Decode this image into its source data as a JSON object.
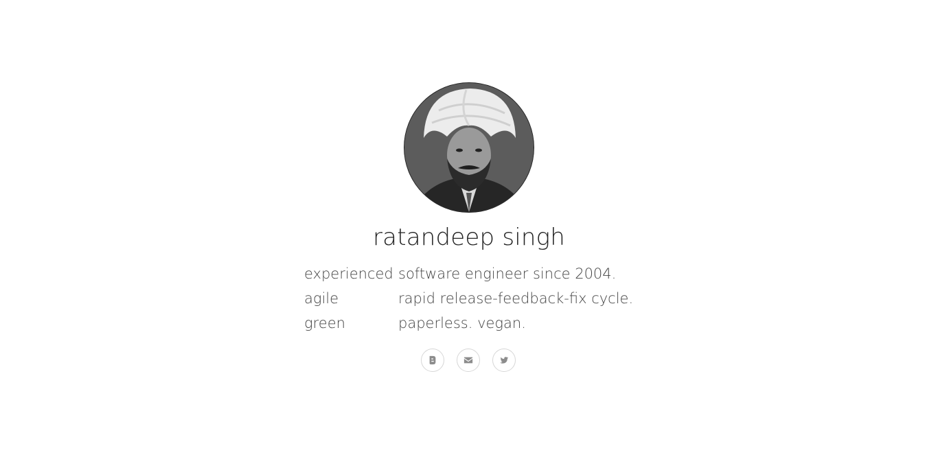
{
  "profile": {
    "name": "ratandeep singh",
    "facts": [
      {
        "key": "experienced",
        "value": "software engineer since 2004."
      },
      {
        "key": "agile",
        "value": "rapid release-feedback-fix cycle."
      },
      {
        "key": "green",
        "value": "paperless. vegan."
      }
    ]
  },
  "social": [
    {
      "icon": "blogger-icon"
    },
    {
      "icon": "envelope-icon"
    },
    {
      "icon": "twitter-icon"
    }
  ]
}
